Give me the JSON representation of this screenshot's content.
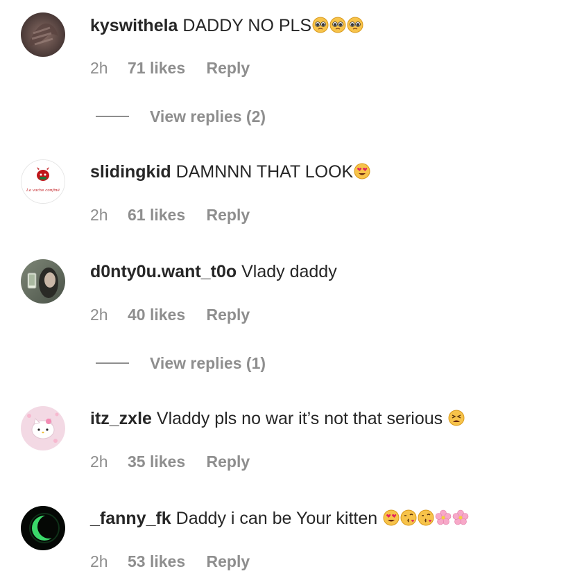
{
  "comments": [
    {
      "username": "kyswithela",
      "text": "DADDY NO PLS",
      "emojis": [
        "pleading-face-emoji",
        "pleading-face-emoji",
        "pleading-face-emoji"
      ],
      "time": "2h",
      "likes": "71 likes",
      "reply": "Reply",
      "view_replies": "View replies (2)",
      "avatar_icon": "dark-hand-avatar"
    },
    {
      "username": "slidingkid",
      "text": "DAMNNN THAT LOOK",
      "emojis": [
        "heart-eyes-emoji"
      ],
      "time": "2h",
      "likes": "61 likes",
      "reply": "Reply",
      "avatar_logo_text": "La vache confiné",
      "avatar_icon": "red-cow-logo-avatar"
    },
    {
      "username": "d0nty0u.want_t0o",
      "text": "Vlady daddy",
      "time": "2h",
      "likes": "40 likes",
      "reply": "Reply",
      "view_replies": "View replies (1)",
      "avatar_icon": "mirror-selfie-avatar"
    },
    {
      "username": "itz_zxle",
      "text": "Vladdy pls no war it’s not that serious",
      "emojis": [
        "tired-face-emoji"
      ],
      "time": "2h",
      "likes": "35 likes",
      "reply": "Reply",
      "avatar_icon": "hello-kitty-avatar"
    },
    {
      "username": "_fanny_fk",
      "text": "Daddy i can be Your kitten",
      "emojis": [
        "heart-eyes-emoji",
        "kissing-face-emoji",
        "kissing-face-emoji",
        "cherry-blossom-emoji",
        "cherry-blossom-emoji"
      ],
      "time": "2h",
      "likes": "53 likes",
      "reply": "Reply",
      "avatar_icon": "green-moon-avatar"
    }
  ],
  "colors": {
    "text": "#262626",
    "meta": "#8e8e8e",
    "background": "#ffffff"
  }
}
